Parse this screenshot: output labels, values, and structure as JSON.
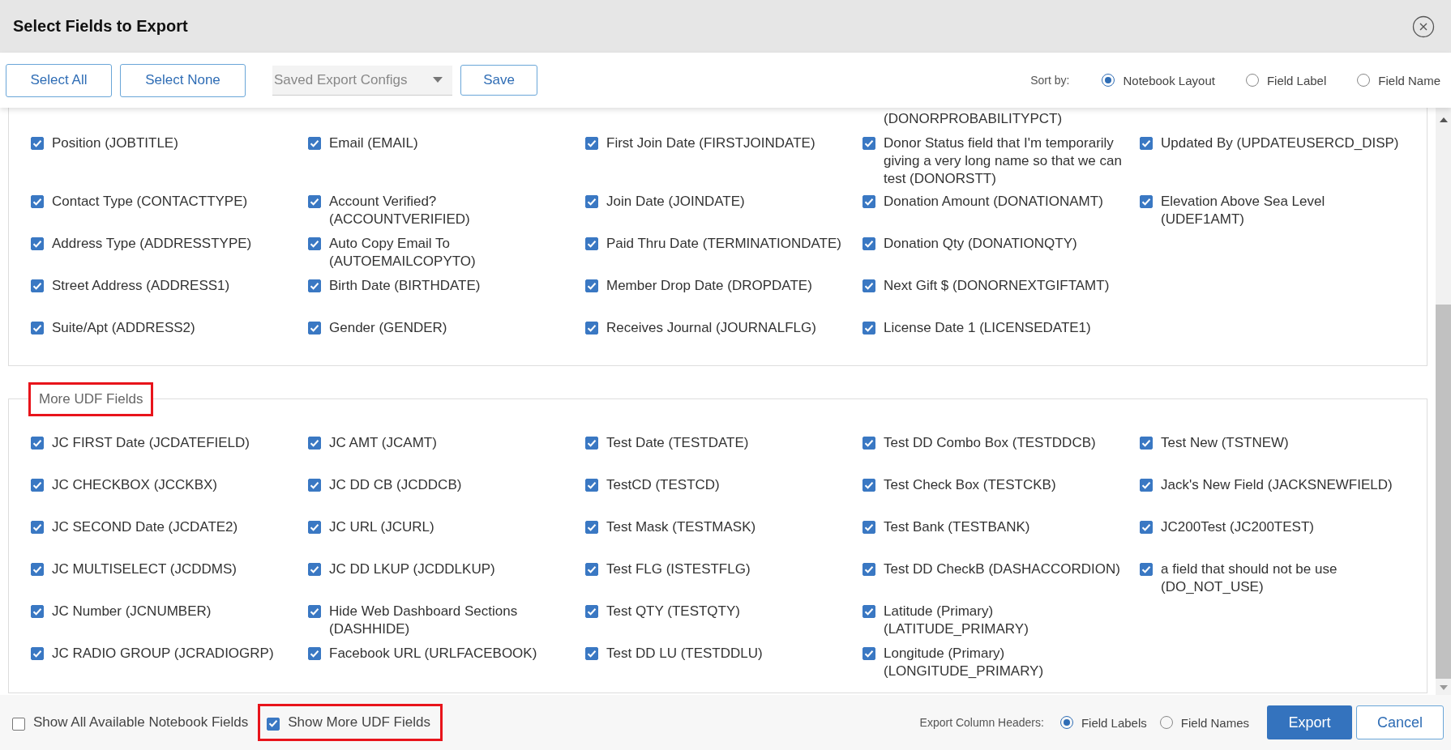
{
  "window": {
    "title": "Select Fields to Export"
  },
  "toolbar": {
    "buttons": [
      "Select All",
      "Select None"
    ],
    "config_select": {
      "placeholder": "Saved Export Configs"
    },
    "save_button": "Save",
    "sort": {
      "label": "Sort by:",
      "options": [
        {
          "label": "Notebook Layout",
          "selected": true
        },
        {
          "label": "Field Label",
          "selected": false
        },
        {
          "label": "Field Name",
          "selected": false
        }
      ]
    }
  },
  "sections": [
    {
      "scrolled_text": "(DONORPROBABILITYPCT)",
      "rows": [
        [
          {
            "label": "Position (JOBTITLE)",
            "checked": true
          },
          {
            "label": "Email (EMAIL)",
            "checked": true
          },
          {
            "label": "First Join Date (FIRSTJOINDATE)",
            "checked": true
          },
          {
            "label": "Donor Status field that I'm temporarily giving a very long name so that we can test (DONORSTT)",
            "checked": true
          },
          {
            "label": "Updated By (UPDATEUSERCD_DISP)",
            "checked": true
          }
        ],
        [
          {
            "label": "Contact Type (CONTACTTYPE)",
            "checked": true
          },
          {
            "label": "Account Verified? (ACCOUNTVERIFIED)",
            "checked": true
          },
          {
            "label": "Join Date (JOINDATE)",
            "checked": true
          },
          {
            "label": "Donation Amount (DONATIONAMT)",
            "checked": true
          },
          {
            "label": "Elevation Above Sea Level (UDEF1AMT)",
            "checked": true
          }
        ],
        [
          {
            "label": "Address Type (ADDRESSTYPE)",
            "checked": true
          },
          {
            "label": "Auto Copy Email To (AUTOEMAILCOPYTO)",
            "checked": true
          },
          {
            "label": "Paid Thru Date (TERMINATIONDATE)",
            "checked": true
          },
          {
            "label": "Donation Qty (DONATIONQTY)",
            "checked": true
          }
        ],
        [
          {
            "label": "Street Address (ADDRESS1)",
            "checked": true
          },
          {
            "label": "Birth Date (BIRTHDATE)",
            "checked": true
          },
          {
            "label": "Member Drop Date (DROPDATE)",
            "checked": true
          },
          {
            "label": "Next Gift $ (DONORNEXTGIFTAMT)",
            "checked": true
          }
        ],
        [
          {
            "label": "Suite/Apt (ADDRESS2)",
            "checked": true
          },
          {
            "label": "Gender (GENDER)",
            "checked": true
          },
          {
            "label": "Receives Journal (JOURNALFLG)",
            "checked": true
          },
          {
            "label": "License Date 1 (LICENSEDATE1)",
            "checked": true
          }
        ]
      ]
    },
    {
      "legend": "More UDF Fields",
      "highlighted": true,
      "rows": [
        [
          {
            "label": "JC FIRST Date (JCDATEFIELD)",
            "checked": true
          },
          {
            "label": "JC AMT (JCAMT)",
            "checked": true
          },
          {
            "label": "Test Date (TESTDATE)",
            "checked": true
          },
          {
            "label": "Test DD Combo Box (TESTDDCB)",
            "checked": true
          },
          {
            "label": "Test New (TSTNEW)",
            "checked": true
          }
        ],
        [
          {
            "label": "JC CHECKBOX (JCCKBX)",
            "checked": true
          },
          {
            "label": "JC DD CB (JCDDCB)",
            "checked": true
          },
          {
            "label": "TestCD (TESTCD)",
            "checked": true
          },
          {
            "label": "Test Check Box (TESTCKB)",
            "checked": true
          },
          {
            "label": "Jack's New Field (JACKSNEWFIELD)",
            "checked": true
          }
        ],
        [
          {
            "label": "JC SECOND Date (JCDATE2)",
            "checked": true
          },
          {
            "label": "JC URL (JCURL)",
            "checked": true
          },
          {
            "label": "Test Mask (TESTMASK)",
            "checked": true
          },
          {
            "label": "Test Bank (TESTBANK)",
            "checked": true
          },
          {
            "label": "JC200Test (JC200TEST)",
            "checked": true
          }
        ],
        [
          {
            "label": "JC MULTISELECT (JCDDMS)",
            "checked": true
          },
          {
            "label": "JC DD LKUP (JCDDLKUP)",
            "checked": true
          },
          {
            "label": "Test FLG (ISTESTFLG)",
            "checked": true
          },
          {
            "label": "Test DD CheckB (DASHACCORDION)",
            "checked": true
          },
          {
            "label": "a field that should not be use (DO_NOT_USE)",
            "checked": true
          }
        ],
        [
          {
            "label": "JC Number (JCNUMBER)",
            "checked": true
          },
          {
            "label": "Hide Web Dashboard Sections (DASHHIDE)",
            "checked": true
          },
          {
            "label": "Test QTY (TESTQTY)",
            "checked": true
          },
          {
            "label": "Latitude (Primary) (LATITUDE_PRIMARY)",
            "checked": true
          }
        ],
        [
          {
            "label": "JC RADIO GROUP (JCRADIOGRP)",
            "checked": true
          },
          {
            "label": "Facebook URL (URLFACEBOOK)",
            "checked": true
          },
          {
            "label": "Test DD LU (TESTDDLU)",
            "checked": true
          },
          {
            "label": "Longitude (Primary) (LONGITUDE_PRIMARY)",
            "checked": true
          }
        ]
      ]
    }
  ],
  "footer": {
    "options": [
      {
        "label": "Show All Available Notebook Fields",
        "checked": false,
        "highlighted": false
      },
      {
        "label": "Show More UDF Fields",
        "checked": true,
        "highlighted": true
      }
    ],
    "headers": {
      "label": "Export Column Headers:",
      "options": [
        {
          "label": "Field Labels",
          "selected": true
        },
        {
          "label": "Field Names",
          "selected": false
        }
      ]
    },
    "export_button": "Export",
    "cancel_button": "Cancel"
  }
}
